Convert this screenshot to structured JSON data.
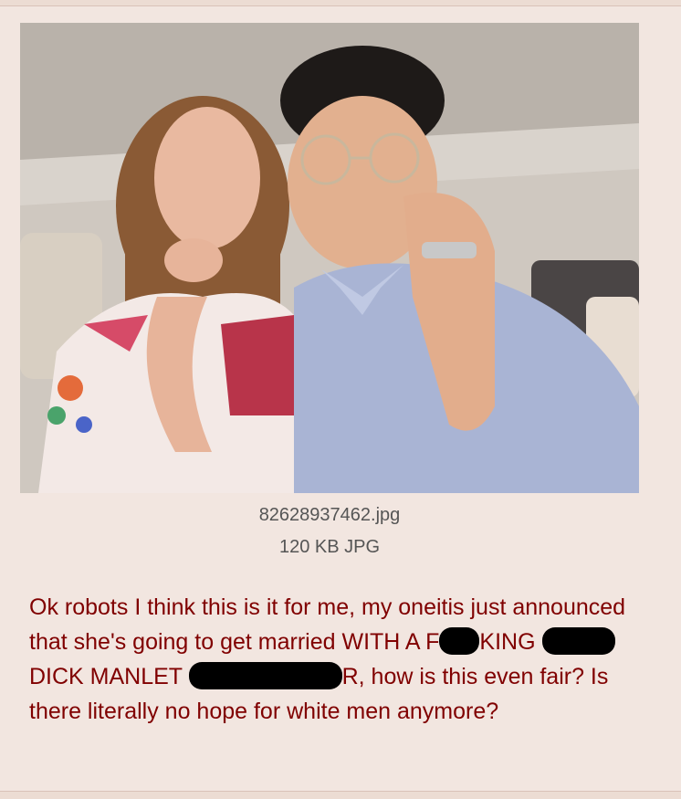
{
  "post": {
    "image_alt": "photo of two people posing together",
    "file_name": "82628937462.jpg",
    "file_meta": "120 KB JPG",
    "text": {
      "part1": "Ok robots I think this is it for me, my oneitis just announced that she's going to get married WITH A F",
      "part2": "KING",
      "part3": "DICK MANLET",
      "part4": "R, how is this even fair? Is there literally no hope for white men anymore?"
    }
  },
  "colors": {
    "background": "#f2e6e0",
    "post_text": "#800000",
    "meta_text": "#555555"
  }
}
